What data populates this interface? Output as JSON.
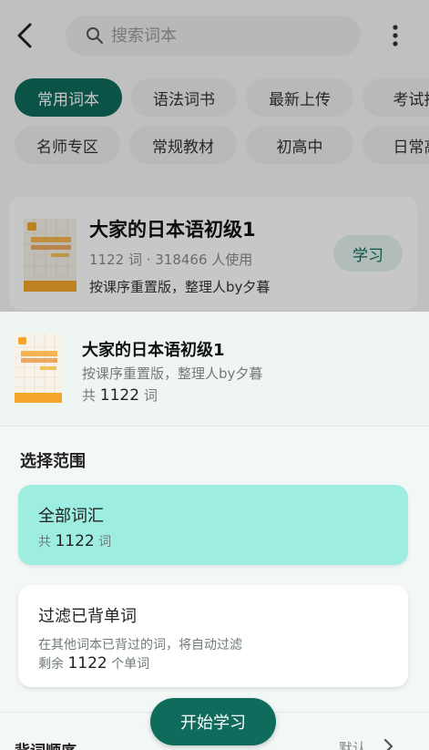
{
  "header": {
    "search_placeholder": "搜索词本"
  },
  "categories": {
    "row1": [
      "常用词本",
      "语法词书",
      "最新上传",
      "考试推"
    ],
    "row2": [
      "名师专区",
      "常规教材",
      "初高中",
      "日常高"
    ],
    "active": "常用词本"
  },
  "book_card": {
    "title": "大家的日本语初级1",
    "meta": "1122 词 · 318466 人使用",
    "description": "按课序重置版，整理人by夕暮",
    "learn_label": "学习"
  },
  "sheet": {
    "title": "大家的日本语初级1",
    "description": "按课序重置版，整理人by夕暮",
    "count_prefix": "共",
    "count": "1122",
    "count_suffix": "词",
    "section_title": "选择范围",
    "options": [
      {
        "title": "全部词汇",
        "prefix": "共",
        "count": "1122",
        "suffix": "词",
        "selected": true
      },
      {
        "title": "过滤已背单词",
        "hint": "在其他词本已背过的词，将自动过滤",
        "prefix": "剩余",
        "count": "1122",
        "suffix": "个单词",
        "selected": false
      }
    ],
    "order_label": "背词顺序",
    "order_value": "默认",
    "start_label": "开始学习"
  },
  "colors": {
    "brand": "#0f6b5b",
    "selected_option": "#9deee0"
  }
}
